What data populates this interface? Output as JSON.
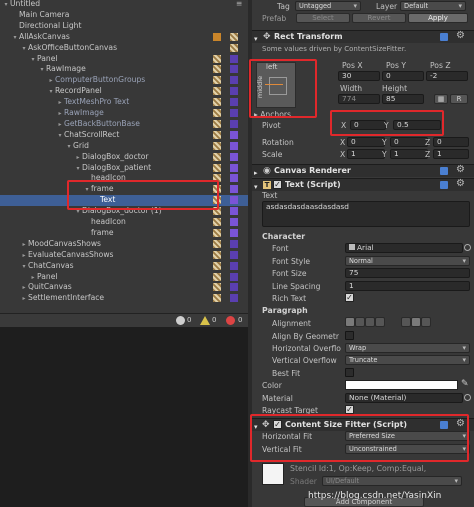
{
  "hierarchy": {
    "items": [
      {
        "label": "Untitled",
        "depth": 0,
        "arrow": "▾",
        "dim": false
      },
      {
        "label": "Main Camera",
        "depth": 1,
        "arrow": "",
        "dim": false
      },
      {
        "label": "Directional Light",
        "depth": 1,
        "arrow": "",
        "dim": false
      },
      {
        "label": "AllAskCanvas",
        "depth": 1,
        "arrow": "▾",
        "dim": false
      },
      {
        "label": "AskOfficeButtonCanvas",
        "depth": 2,
        "arrow": "▾",
        "dim": false
      },
      {
        "label": "Panel",
        "depth": 3,
        "arrow": "▾",
        "dim": false
      },
      {
        "label": "RawImage",
        "depth": 4,
        "arrow": "▾",
        "dim": false
      },
      {
        "label": "ComputerButtonGroups",
        "depth": 5,
        "arrow": "▸",
        "dim": true
      },
      {
        "label": "RecordPanel",
        "depth": 5,
        "arrow": "▾",
        "dim": false
      },
      {
        "label": "TextMeshPro Text",
        "depth": 6,
        "arrow": "▸",
        "dim": true
      },
      {
        "label": "RawImage",
        "depth": 6,
        "arrow": "▸",
        "dim": true
      },
      {
        "label": "GetBackButtonBase",
        "depth": 6,
        "arrow": "▸",
        "dim": true
      },
      {
        "label": "ChatScrollRect",
        "depth": 6,
        "arrow": "▾",
        "dim": false
      },
      {
        "label": "Grid",
        "depth": 7,
        "arrow": "▾",
        "dim": false
      },
      {
        "label": "DialogBox_doctor",
        "depth": 8,
        "arrow": "▸",
        "dim": false
      },
      {
        "label": "DialogBox_patient",
        "depth": 8,
        "arrow": "▾",
        "dim": false
      },
      {
        "label": "headIcon",
        "depth": 9,
        "arrow": "",
        "dim": false
      },
      {
        "label": "frame",
        "depth": 9,
        "arrow": "▾",
        "dim": false
      },
      {
        "label": "Text",
        "depth": 10,
        "arrow": "",
        "dim": false,
        "selected": true
      },
      {
        "label": "DialogBox_doctor (1)",
        "depth": 8,
        "arrow": "▾",
        "dim": false
      },
      {
        "label": "headIcon",
        "depth": 9,
        "arrow": "",
        "dim": false
      },
      {
        "label": "frame",
        "depth": 9,
        "arrow": "",
        "dim": false
      },
      {
        "label": "MoodCanvasShows",
        "depth": 2,
        "arrow": "▸",
        "dim": false
      },
      {
        "label": "EvaluateCanvasShows",
        "depth": 2,
        "arrow": "▸",
        "dim": false
      },
      {
        "label": "ChatCanvas",
        "depth": 2,
        "arrow": "▾",
        "dim": false
      },
      {
        "label": "Panel",
        "depth": 3,
        "arrow": "▸",
        "dim": false
      },
      {
        "label": "QuitCanvas",
        "depth": 2,
        "arrow": "▸",
        "dim": false
      },
      {
        "label": "SettlementInterface",
        "depth": 2,
        "arrow": "▸",
        "dim": false
      }
    ],
    "bottom_counts": [
      "0",
      "0",
      "0"
    ]
  },
  "inspector": {
    "header": {
      "tag_label": "Tag",
      "tag_value": "Untagged",
      "layer_label": "Layer",
      "layer_value": "Default",
      "prefab_label": "Prefab",
      "select_label": "Select",
      "revert_label": "Revert",
      "apply_label": "Apply"
    },
    "rect_transform": {
      "title": "Rect Transform",
      "note": "Some values driven by ContentSizeFitter.",
      "anchor_left": "left",
      "anchor_middle": "middle",
      "col_headers": [
        "Pos X",
        "Pos Y",
        "Pos Z"
      ],
      "pos_values": [
        "30",
        "0",
        "-2"
      ],
      "size_headers": [
        "Width",
        "Height"
      ],
      "size_values": [
        "774",
        "85"
      ],
      "anchors_label": "Anchors",
      "pivot_label": "Pivot",
      "pivot_x_label": "X",
      "pivot_x": "0",
      "pivot_y_label": "Y",
      "pivot_y": "0.5",
      "rotation_label": "Rotation",
      "rotation": [
        "0",
        "0",
        "0"
      ],
      "scale_label": "Scale",
      "scale": [
        "1",
        "1",
        "1"
      ],
      "axis_x": "X",
      "axis_y": "Y",
      "axis_z": "Z",
      "r_button": "R"
    },
    "canvas_renderer": {
      "title": "Canvas Renderer"
    },
    "text_script": {
      "title": "Text (Script)",
      "text_label": "Text",
      "text_value": "asdasdasdaasdasdasd",
      "character_label": "Character",
      "font_label": "Font",
      "font_value": "Arial",
      "font_style_label": "Font Style",
      "font_style_value": "Normal",
      "font_size_label": "Font Size",
      "font_size_value": "75",
      "line_spacing_label": "Line Spacing",
      "line_spacing_value": "1",
      "rich_text_label": "Rich Text",
      "paragraph_label": "Paragraph",
      "alignment_label": "Alignment",
      "align_geom_label": "Align By Geometr",
      "h_overflow_label": "Horizontal Overflo",
      "h_overflow_value": "Wrap",
      "v_overflow_label": "Vertical Overflow",
      "v_overflow_value": "Truncate",
      "best_fit_label": "Best Fit",
      "color_label": "Color",
      "material_label": "Material",
      "material_value": "None (Material)",
      "raycast_label": "Raycast Target"
    },
    "content_size_fitter": {
      "title": "Content Size Fitter (Script)",
      "h_fit_label": "Horizontal Fit",
      "h_fit_value": "Preferred Size",
      "v_fit_label": "Vertical Fit",
      "v_fit_value": "Unconstrained"
    },
    "material_footer": {
      "stencil_text": "Stencil Id:1, Op:Keep, Comp:Equal,",
      "shader_label": "Shader",
      "shader_value": "UI/Default",
      "add_component_label": "Add Component"
    }
  },
  "watermark": "https://blog.csdn.net/YasinXin"
}
